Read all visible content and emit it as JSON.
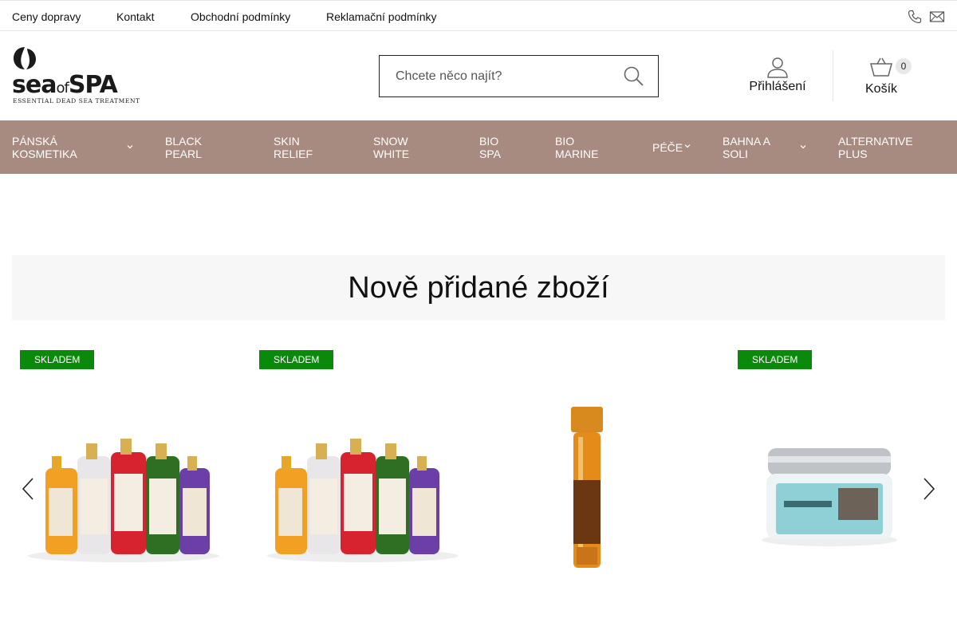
{
  "topbar": {
    "links": [
      "Ceny dopravy",
      "Kontakt",
      "Obchodní podmínky",
      "Reklamační podmínky"
    ],
    "icons": [
      "phone-icon",
      "mail-icon"
    ]
  },
  "brand": {
    "name_sea": "sea",
    "name_of": "of",
    "name_spa": "SPA",
    "tagline": "ESSENTIAL DEAD SEA TREATMENT"
  },
  "search": {
    "placeholder": "Chcete něco najít?"
  },
  "account": {
    "login_label": "Přihlášení",
    "cart_label": "Košík",
    "cart_count": "0"
  },
  "nav": {
    "items": [
      {
        "line1": "PÁNSKÁ",
        "line2": "KOSMETIKA",
        "dropdown": true
      },
      {
        "line1": "BLACK",
        "line2": "PEARL",
        "dropdown": false
      },
      {
        "line1": "SKIN",
        "line2": "RELIEF",
        "dropdown": false
      },
      {
        "line1": "SNOW",
        "line2": "WHITE",
        "dropdown": false
      },
      {
        "line1": "BIO",
        "line2": "SPA",
        "dropdown": false
      },
      {
        "line1": "BIO",
        "line2": "MARINE",
        "dropdown": false
      },
      {
        "line1": "PÉČE",
        "line2": "",
        "dropdown": true
      },
      {
        "line1": "BAHNA A",
        "line2": "SOLI",
        "dropdown": true
      },
      {
        "line1": "ALTERNATIVE",
        "line2": "PLUS",
        "dropdown": false
      }
    ]
  },
  "section": {
    "title": "Nově přidané zboží"
  },
  "products": [
    {
      "badge": "SKLADEM"
    },
    {
      "badge": "SKLADEM"
    },
    {
      "badge": ""
    },
    {
      "badge": "SKLADEM"
    }
  ],
  "colors": {
    "nav_bg": "#a78b80",
    "badge_bg": "#0a8a0a"
  }
}
